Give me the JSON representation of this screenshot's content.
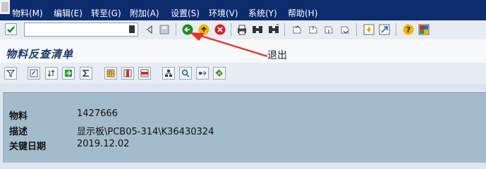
{
  "menubar": {
    "items": [
      "物料(M)",
      "编辑(E)",
      "转至(G)",
      "附加(A)",
      "设置(S)",
      "环境(V)",
      "系统(Y)",
      "帮助(H)"
    ]
  },
  "toolbar": {
    "command_field_value": "",
    "icons": [
      "enter-check-icon",
      "dropdown-icon",
      "back-triangle-icon",
      "save-icon",
      "back-icon",
      "exit-icon",
      "cancel-icon",
      "print-icon",
      "find-icon",
      "find-next-icon",
      "first-page-icon",
      "prev-page-icon",
      "next-page-icon",
      "last-page-icon",
      "create-session-icon",
      "shortcut-icon",
      "help-icon",
      "customize-layout-icon"
    ]
  },
  "screen": {
    "title": "物料反查清单",
    "annotation": "退出"
  },
  "app_toolbar": {
    "icons": [
      "filter-icon",
      "select-layout-icon",
      "sort-icon",
      "export-icon",
      "sum-icon",
      "table-icon",
      "column-icon",
      "row-icon",
      "hierarchy-icon",
      "zoom-icon",
      "expand-icon",
      "settings-icon"
    ]
  },
  "details": {
    "rows": [
      {
        "label": "物料",
        "value": "1427666"
      },
      {
        "label": "描述",
        "value": "显示板\\PCB05-314\\K36430324"
      },
      {
        "label": "关键日期",
        "value": "2019.12.02"
      }
    ]
  },
  "colors": {
    "menubar": "#0d2c6e",
    "panel": "#a3bccb",
    "arrow": "#e8322a"
  }
}
